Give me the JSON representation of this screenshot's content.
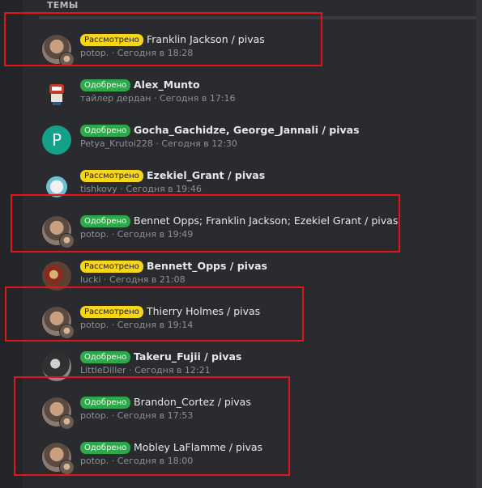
{
  "section_title": "ТЕМЫ",
  "threads": [
    {
      "status": "Рассмотрено",
      "status_type": "review",
      "title": "Franklin Jackson / pivas",
      "bold": false,
      "author": "potop.",
      "time": "Сегодня в 18:28",
      "avatar": "photo-avatar",
      "highlighted": true
    },
    {
      "status": "Одобрено",
      "status_type": "approved",
      "title": "Alex_Munto",
      "bold": true,
      "author": "тайлер дердан",
      "time": "Сегодня в 17:16",
      "avatar": "pixel-avatar",
      "highlighted": false
    },
    {
      "status": "Одобрено",
      "status_type": "approved",
      "title": "Gocha_Gachidze, George_Jannali / pivas",
      "bold": true,
      "author": "Petya_Krutoi228",
      "time": "Сегодня в 12:30",
      "avatar": "letter-avatar",
      "avatar_letter": "P",
      "highlighted": false
    },
    {
      "status": "Рассмотрено",
      "status_type": "review",
      "title": "Ezekiel_Grant / pivas",
      "bold": true,
      "author": "tishkovy",
      "time": "Сегодня в 19:46",
      "avatar": "anime-avatar",
      "highlighted": false
    },
    {
      "status": "Одобрено",
      "status_type": "approved",
      "title": "Bennet Opps; Franklin Jackson; Ezekiel Grant / pivas",
      "bold": false,
      "author": "potop.",
      "time": "Сегодня в 19:49",
      "avatar": "photo-avatar",
      "highlighted": true
    },
    {
      "status": "Рассмотрено",
      "status_type": "review",
      "title": "Bennett_Opps / pivas",
      "bold": true,
      "author": "lucki",
      "time": "Сегодня в 21:08",
      "avatar": "painting-avatar",
      "highlighted": false
    },
    {
      "status": "Рассмотрено",
      "status_type": "review",
      "title": "Thierry Holmes / pivas",
      "bold": false,
      "author": "potop.",
      "time": "Сегодня в 19:14",
      "avatar": "photo-avatar",
      "highlighted": true
    },
    {
      "status": "Одобрено",
      "status_type": "approved",
      "title": "Takeru_Fujii / pivas",
      "bold": true,
      "author": "LittleDiller",
      "time": "Сегодня в 12:21",
      "avatar": "bw-avatar",
      "highlighted": false
    },
    {
      "status": "Одобрено",
      "status_type": "approved",
      "title": "Brandon_Cortez / pivas",
      "bold": false,
      "author": "potop.",
      "time": "Сегодня в 17:53",
      "avatar": "photo-avatar",
      "highlighted": true
    },
    {
      "status": "Одобрено",
      "status_type": "approved",
      "title": "Mobley LaFlamme / pivas",
      "bold": false,
      "author": "potop.",
      "time": "Сегодня в 18:00",
      "avatar": "photo-avatar",
      "highlighted": true
    }
  ],
  "meta_separator": " · ",
  "colors": {
    "review_badge": "#f6d51c",
    "approved_badge": "#2fa84b",
    "highlight_box": "#e0161a",
    "background": "#2a2b2f"
  }
}
